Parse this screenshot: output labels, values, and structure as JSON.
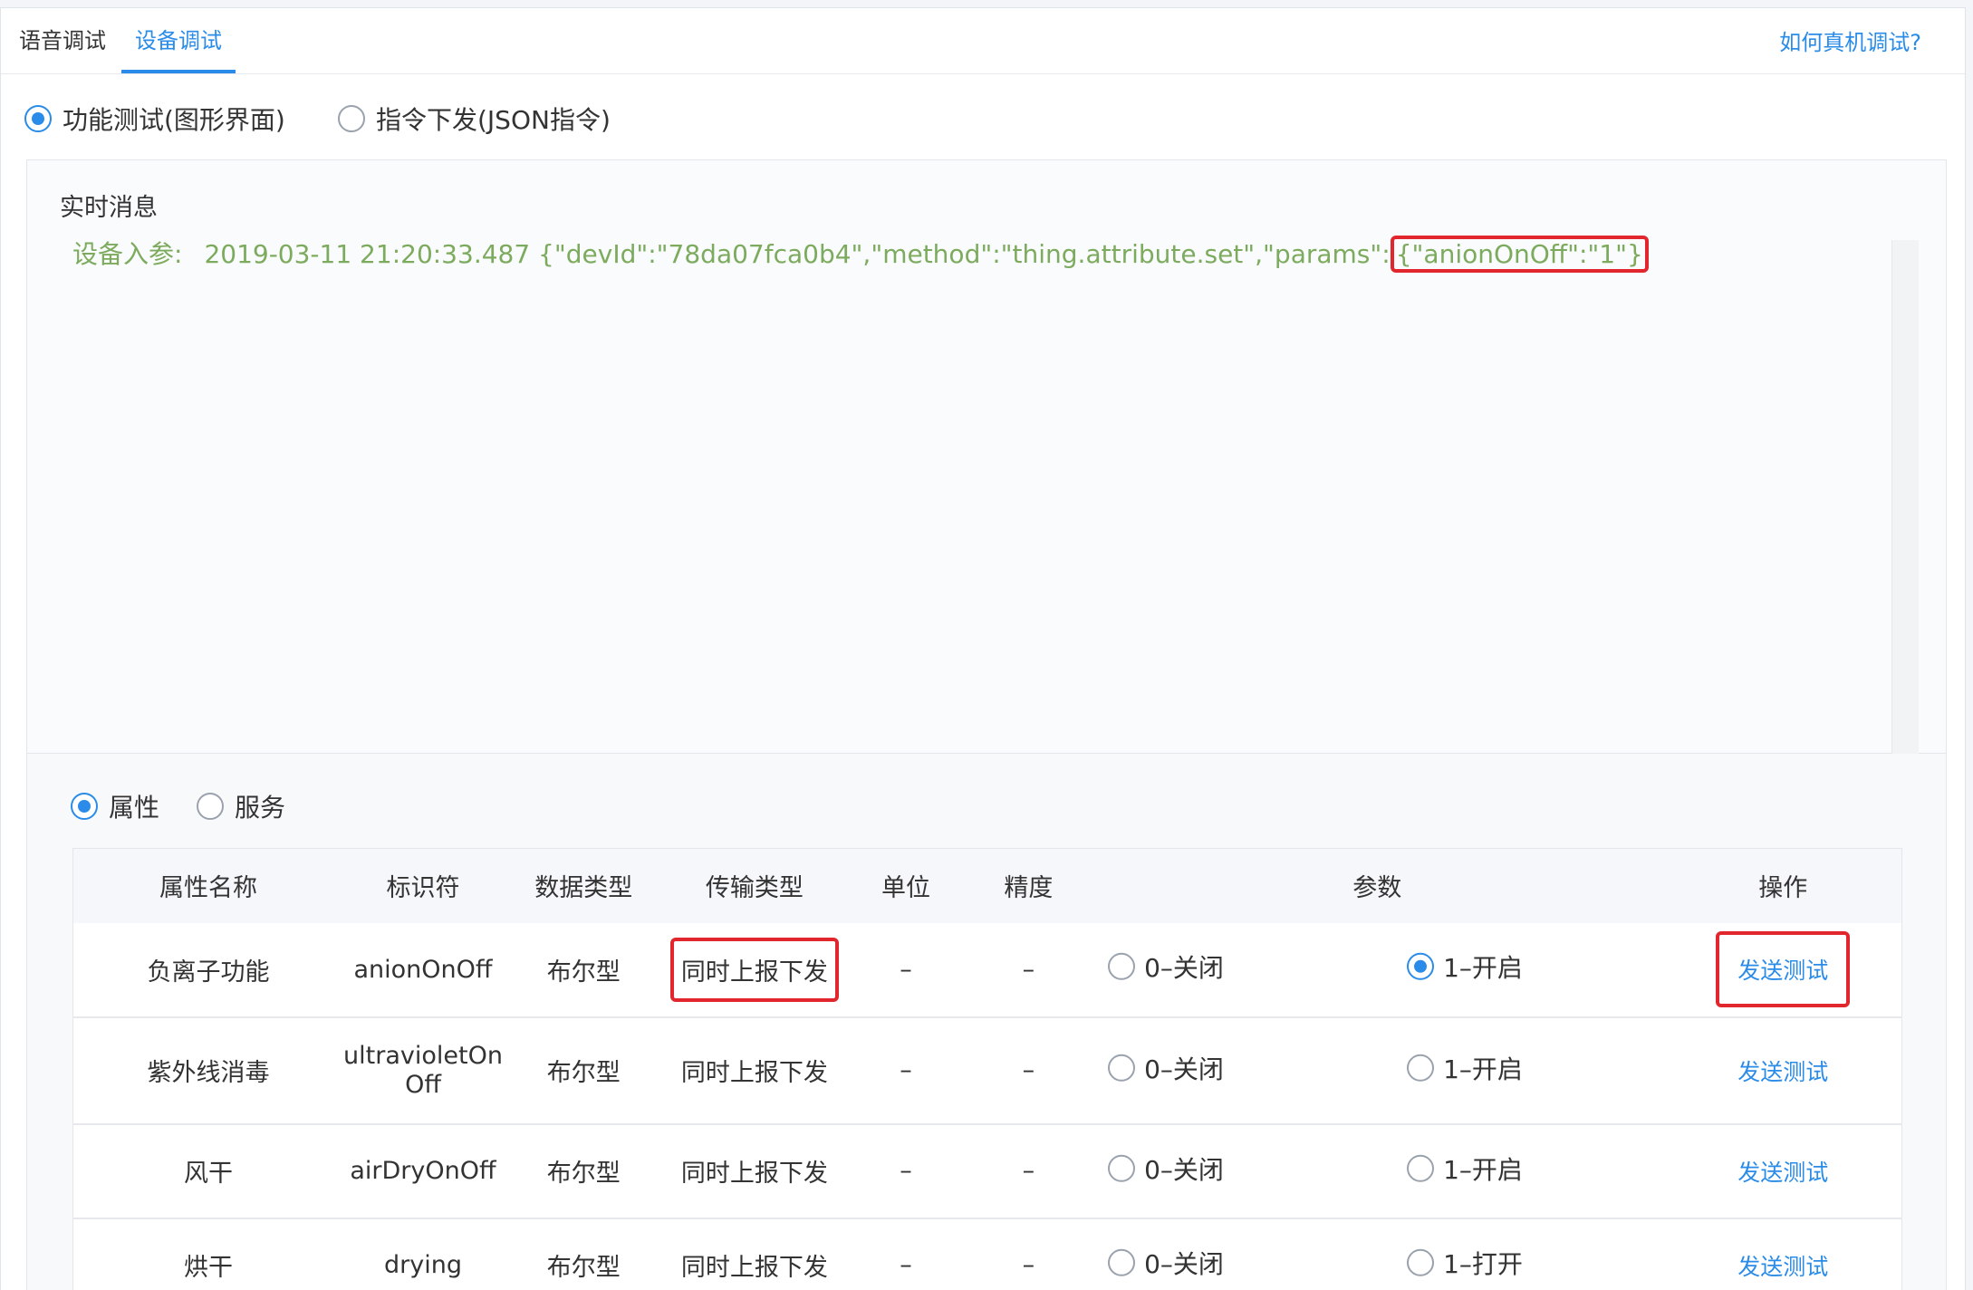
{
  "tabs": [
    {
      "label": "语音调试",
      "active": false
    },
    {
      "label": "设备调试",
      "active": true
    }
  ],
  "help_link": "如何真机调试?",
  "mode_radios": [
    {
      "label": "功能测试(图形界面)",
      "checked": true
    },
    {
      "label": "指令下发(JSON指令)",
      "checked": false
    }
  ],
  "realtime": {
    "title": "实时消息",
    "line_label": "设备入参:",
    "line_text": "2019-03-11 21:20:33.487 {\"devId\":\"78da07fca0b4\",\"method\":\"thing.attribute.set\",\"params\":",
    "line_highlight": "{\"anionOnOff\":\"1\"}"
  },
  "type_radios": [
    {
      "label": "属性",
      "checked": true
    },
    {
      "label": "服务",
      "checked": false
    }
  ],
  "table": {
    "headers": [
      "属性名称",
      "标识符",
      "数据类型",
      "传输类型",
      "单位",
      "精度",
      "参数",
      "操作"
    ],
    "rows": [
      {
        "name": "负离子功能",
        "id_a": "anionOnOff",
        "id_b": "",
        "dtype": "布尔型",
        "ttype": "同时上报下发",
        "unit": "–",
        "precision": "–",
        "opt0": "0–关闭",
        "opt1": "1–开启",
        "selected": 1,
        "action": "发送测试"
      },
      {
        "name": "紫外线消毒",
        "id_a": "ultravioletOn",
        "id_b": "Off",
        "dtype": "布尔型",
        "ttype": "同时上报下发",
        "unit": "–",
        "precision": "–",
        "opt0": "0–关闭",
        "opt1": "1–开启",
        "selected": -1,
        "action": "发送测试"
      },
      {
        "name": "风干",
        "id_a": "airDryOnOff",
        "id_b": "",
        "dtype": "布尔型",
        "ttype": "同时上报下发",
        "unit": "–",
        "precision": "–",
        "opt0": "0–关闭",
        "opt1": "1–开启",
        "selected": -1,
        "action": "发送测试"
      },
      {
        "name": "烘干",
        "id_a": "drying",
        "id_b": "",
        "dtype": "布尔型",
        "ttype": "同时上报下发",
        "unit": "–",
        "precision": "–",
        "opt0": "0–关闭",
        "opt1": "1–打开",
        "selected": -1,
        "action": "发送测试"
      }
    ]
  },
  "colors": {
    "accent": "#2a8ce8",
    "highlight": "#e1262d",
    "log_text": "#7cab5e"
  }
}
